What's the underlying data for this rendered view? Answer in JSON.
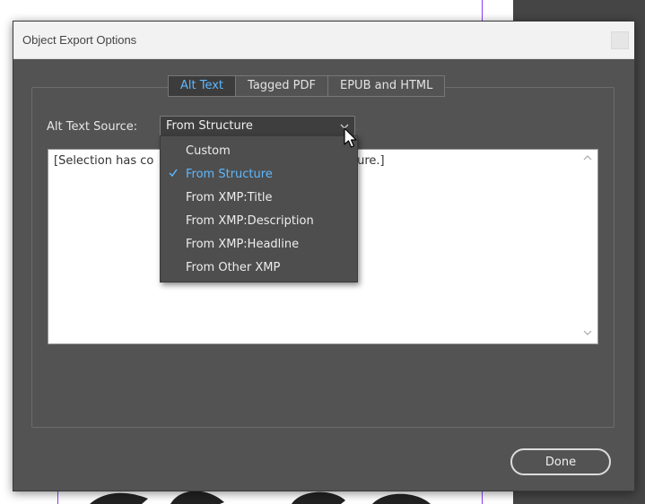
{
  "window": {
    "title": "Object Export Options"
  },
  "tabs": [
    {
      "label": "Alt Text",
      "active": true
    },
    {
      "label": "Tagged PDF",
      "active": false
    },
    {
      "label": "EPUB and HTML",
      "active": false
    }
  ],
  "alt_text": {
    "source_label": "Alt Text Source:",
    "selected_value": "From Structure",
    "text_visible_left": "[Selection has co",
    "text_visible_right": "ture.]"
  },
  "dropdown": {
    "options": [
      {
        "label": "Custom",
        "selected": false
      },
      {
        "label": "From Structure",
        "selected": true
      },
      {
        "label": "From XMP:Title",
        "selected": false
      },
      {
        "label": "From XMP:Description",
        "selected": false
      },
      {
        "label": "From XMP:Headline",
        "selected": false
      },
      {
        "label": "From Other XMP",
        "selected": false
      }
    ],
    "check_icon": "checkmark-icon"
  },
  "buttons": {
    "done_label": "Done"
  },
  "colors": {
    "dialog_bg": "#535353",
    "accent_blue": "#5db8ff",
    "guide_purple": "#8a3cff"
  }
}
